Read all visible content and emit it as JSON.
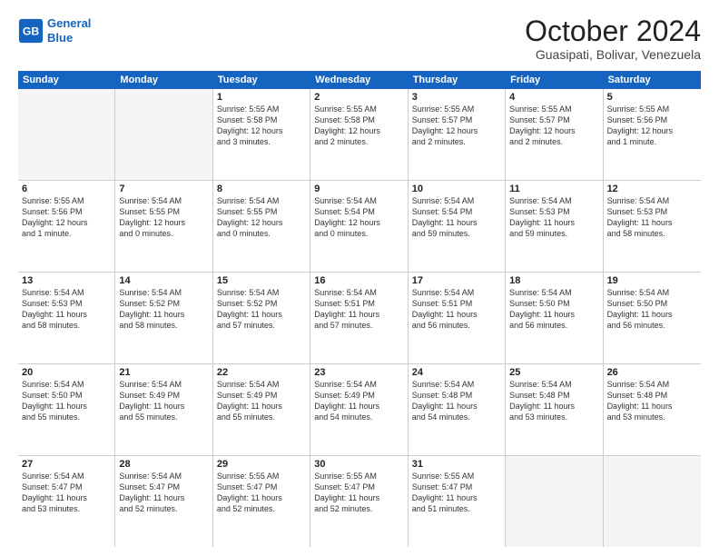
{
  "header": {
    "logo_line1": "General",
    "logo_line2": "Blue",
    "month": "October 2024",
    "location": "Guasipati, Bolivar, Venezuela"
  },
  "days_of_week": [
    "Sunday",
    "Monday",
    "Tuesday",
    "Wednesday",
    "Thursday",
    "Friday",
    "Saturday"
  ],
  "weeks": [
    [
      {
        "day": "",
        "info": "",
        "empty": true
      },
      {
        "day": "",
        "info": "",
        "empty": true
      },
      {
        "day": "1",
        "info": "Sunrise: 5:55 AM\nSunset: 5:58 PM\nDaylight: 12 hours\nand 3 minutes."
      },
      {
        "day": "2",
        "info": "Sunrise: 5:55 AM\nSunset: 5:58 PM\nDaylight: 12 hours\nand 2 minutes."
      },
      {
        "day": "3",
        "info": "Sunrise: 5:55 AM\nSunset: 5:57 PM\nDaylight: 12 hours\nand 2 minutes."
      },
      {
        "day": "4",
        "info": "Sunrise: 5:55 AM\nSunset: 5:57 PM\nDaylight: 12 hours\nand 2 minutes."
      },
      {
        "day": "5",
        "info": "Sunrise: 5:55 AM\nSunset: 5:56 PM\nDaylight: 12 hours\nand 1 minute."
      }
    ],
    [
      {
        "day": "6",
        "info": "Sunrise: 5:55 AM\nSunset: 5:56 PM\nDaylight: 12 hours\nand 1 minute."
      },
      {
        "day": "7",
        "info": "Sunrise: 5:54 AM\nSunset: 5:55 PM\nDaylight: 12 hours\nand 0 minutes."
      },
      {
        "day": "8",
        "info": "Sunrise: 5:54 AM\nSunset: 5:55 PM\nDaylight: 12 hours\nand 0 minutes."
      },
      {
        "day": "9",
        "info": "Sunrise: 5:54 AM\nSunset: 5:54 PM\nDaylight: 12 hours\nand 0 minutes."
      },
      {
        "day": "10",
        "info": "Sunrise: 5:54 AM\nSunset: 5:54 PM\nDaylight: 11 hours\nand 59 minutes."
      },
      {
        "day": "11",
        "info": "Sunrise: 5:54 AM\nSunset: 5:53 PM\nDaylight: 11 hours\nand 59 minutes."
      },
      {
        "day": "12",
        "info": "Sunrise: 5:54 AM\nSunset: 5:53 PM\nDaylight: 11 hours\nand 58 minutes."
      }
    ],
    [
      {
        "day": "13",
        "info": "Sunrise: 5:54 AM\nSunset: 5:53 PM\nDaylight: 11 hours\nand 58 minutes."
      },
      {
        "day": "14",
        "info": "Sunrise: 5:54 AM\nSunset: 5:52 PM\nDaylight: 11 hours\nand 58 minutes."
      },
      {
        "day": "15",
        "info": "Sunrise: 5:54 AM\nSunset: 5:52 PM\nDaylight: 11 hours\nand 57 minutes."
      },
      {
        "day": "16",
        "info": "Sunrise: 5:54 AM\nSunset: 5:51 PM\nDaylight: 11 hours\nand 57 minutes."
      },
      {
        "day": "17",
        "info": "Sunrise: 5:54 AM\nSunset: 5:51 PM\nDaylight: 11 hours\nand 56 minutes."
      },
      {
        "day": "18",
        "info": "Sunrise: 5:54 AM\nSunset: 5:50 PM\nDaylight: 11 hours\nand 56 minutes."
      },
      {
        "day": "19",
        "info": "Sunrise: 5:54 AM\nSunset: 5:50 PM\nDaylight: 11 hours\nand 56 minutes."
      }
    ],
    [
      {
        "day": "20",
        "info": "Sunrise: 5:54 AM\nSunset: 5:50 PM\nDaylight: 11 hours\nand 55 minutes."
      },
      {
        "day": "21",
        "info": "Sunrise: 5:54 AM\nSunset: 5:49 PM\nDaylight: 11 hours\nand 55 minutes."
      },
      {
        "day": "22",
        "info": "Sunrise: 5:54 AM\nSunset: 5:49 PM\nDaylight: 11 hours\nand 55 minutes."
      },
      {
        "day": "23",
        "info": "Sunrise: 5:54 AM\nSunset: 5:49 PM\nDaylight: 11 hours\nand 54 minutes."
      },
      {
        "day": "24",
        "info": "Sunrise: 5:54 AM\nSunset: 5:48 PM\nDaylight: 11 hours\nand 54 minutes."
      },
      {
        "day": "25",
        "info": "Sunrise: 5:54 AM\nSunset: 5:48 PM\nDaylight: 11 hours\nand 53 minutes."
      },
      {
        "day": "26",
        "info": "Sunrise: 5:54 AM\nSunset: 5:48 PM\nDaylight: 11 hours\nand 53 minutes."
      }
    ],
    [
      {
        "day": "27",
        "info": "Sunrise: 5:54 AM\nSunset: 5:47 PM\nDaylight: 11 hours\nand 53 minutes."
      },
      {
        "day": "28",
        "info": "Sunrise: 5:54 AM\nSunset: 5:47 PM\nDaylight: 11 hours\nand 52 minutes."
      },
      {
        "day": "29",
        "info": "Sunrise: 5:55 AM\nSunset: 5:47 PM\nDaylight: 11 hours\nand 52 minutes."
      },
      {
        "day": "30",
        "info": "Sunrise: 5:55 AM\nSunset: 5:47 PM\nDaylight: 11 hours\nand 52 minutes."
      },
      {
        "day": "31",
        "info": "Sunrise: 5:55 AM\nSunset: 5:47 PM\nDaylight: 11 hours\nand 51 minutes."
      },
      {
        "day": "",
        "info": "",
        "empty": true
      },
      {
        "day": "",
        "info": "",
        "empty": true
      }
    ]
  ]
}
